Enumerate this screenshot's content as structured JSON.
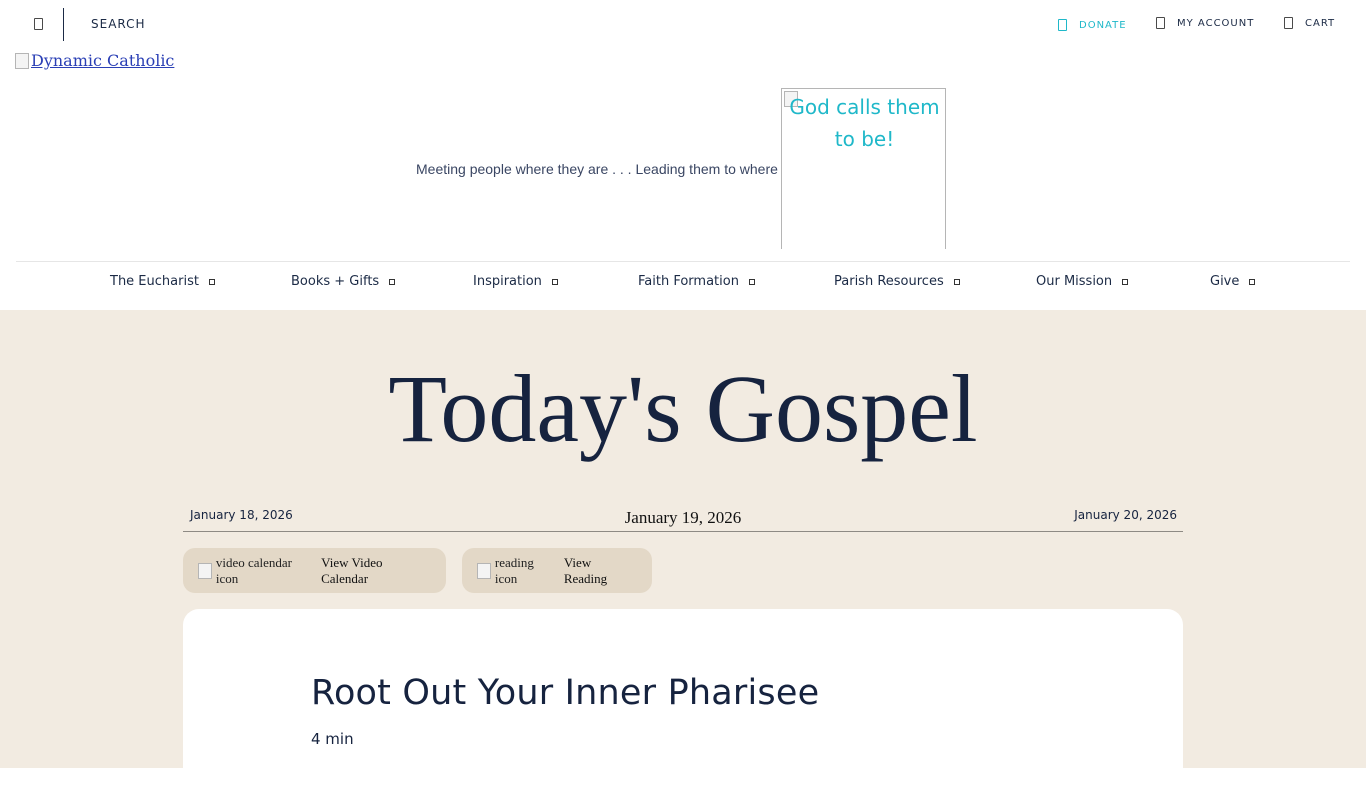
{
  "topbar": {
    "search_label": "SEARCH",
    "donate_label": "DONATE",
    "account_label": "MY ACCOUNT",
    "cart_label": "CART"
  },
  "logo": {
    "alt_text": "Dynamic Catholic"
  },
  "tagline": {
    "text": "Meeting people where they are . . . Leading them to where",
    "image_alt": "God calls them to be!"
  },
  "nav": {
    "items": [
      {
        "label": "The Eucharist"
      },
      {
        "label": "Books + Gifts"
      },
      {
        "label": "Inspiration"
      },
      {
        "label": "Faith Formation"
      },
      {
        "label": "Parish Resources"
      },
      {
        "label": "Our Mission"
      },
      {
        "label": "Give"
      }
    ]
  },
  "gospel": {
    "title": "Today's Gospel",
    "date_prev": "January 18, 2026",
    "date_current": "January 19, 2026",
    "date_next": "January 20, 2026",
    "video_icon_alt": "video calendar icon",
    "video_label": "View Video Calendar",
    "reading_icon_alt": "reading icon",
    "reading_label": "View Reading",
    "card_title": "Root Out Your Inner Pharisee",
    "card_duration": "4 min"
  },
  "colors": {
    "accent": "#1fb8c9",
    "navy": "#16233f",
    "beige_bg": "#f2ebe1",
    "pill_bg": "#e3d8c7"
  }
}
